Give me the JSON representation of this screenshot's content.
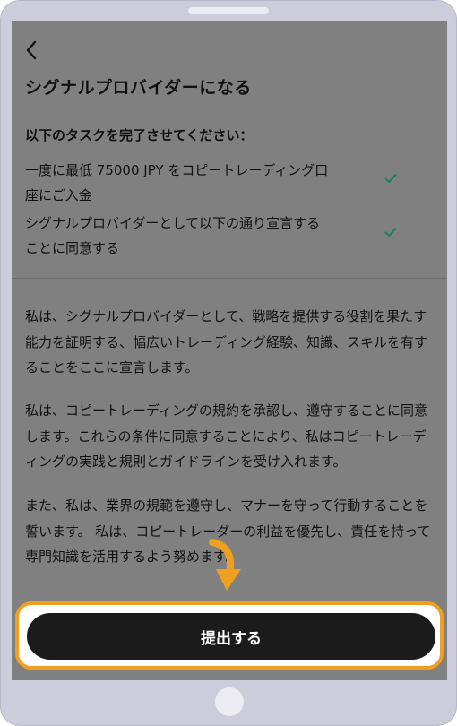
{
  "header": {
    "back_icon": "chevron-left-icon",
    "title": "シグナルプロバイダーになる"
  },
  "tasks": {
    "header": "以下のタスクを完了させてください：",
    "items": [
      {
        "label": "一度に最低 75000 JPY をコピートレーディング口座にご入金",
        "status": "done",
        "icon": "check-icon"
      },
      {
        "label": "シグナルプロバイダーとして以下の通り宣言することに同意する",
        "status": "done",
        "icon": "check-icon"
      }
    ]
  },
  "declaration": {
    "paragraphs": [
      "私は、シグナルプロバイダーとして、戦略を提供する役割を果たす能力を証明する、幅広いトレーディング経験、知識、スキルを有することをここに宣言します。",
      "私は、コピートレーディングの規約を承認し、遵守することに同意します。これらの条件に同意することにより、私はコピートレーディングの実践と規則とガイドラインを受け入れます。",
      "また、私は、業界の規範を遵守し、マナーを守って行動することを誓います。 私は、コピートレーダーの利益を優先し、責任を持って専門知識を活用するよう努めます。"
    ]
  },
  "submit": {
    "label": "提出する"
  },
  "colors": {
    "overlay": "#808080",
    "check": "#1a7f5a",
    "highlight": "#f0a020",
    "button": "#1b1b1b"
  }
}
